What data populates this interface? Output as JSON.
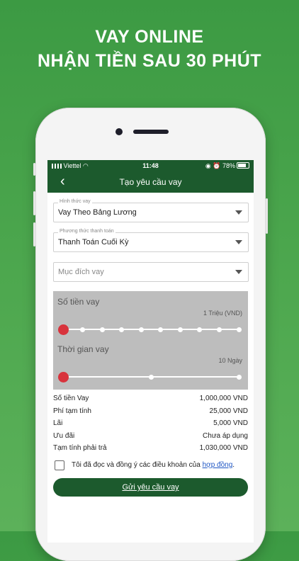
{
  "headline": {
    "line1": "VAY ONLINE",
    "line2": "NHẬN TIỀN SAU 30 PHÚT"
  },
  "status_bar": {
    "carrier": "Viettel",
    "time": "11:48",
    "battery": "78%",
    "battery_level": 0.78
  },
  "nav": {
    "title": "Tạo yêu cầu vay"
  },
  "form": {
    "loan_type": {
      "label": "Hình thức vay",
      "value": "Vay Theo Bảng Lương"
    },
    "payment_method": {
      "label": "Phương thức thanh toán",
      "value": "Thanh Toán Cuối Kỳ"
    },
    "purpose": {
      "placeholder": "Mục đích vay"
    }
  },
  "amount_slider": {
    "title": "Số tiền vay",
    "value_text": "1 Triệu (VND)",
    "steps": 10,
    "selected_index": 0
  },
  "term_slider": {
    "title": "Thời gian vay",
    "value_text": "10 Ngày",
    "steps": 3,
    "selected_index": 0
  },
  "summary": [
    {
      "label": "Số tiền Vay",
      "value": "1,000,000 VND"
    },
    {
      "label": "Phí tạm tính",
      "value": "25,000 VND"
    },
    {
      "label": "Lãi",
      "value": "5,000 VND"
    },
    {
      "label": "Ưu đãi",
      "value": "Chưa áp dụng"
    },
    {
      "label": "Tạm tính phải trả",
      "value": "1,030,000 VND"
    }
  ],
  "agreement": {
    "text": "Tôi đã đọc và đồng ý các điều khoản của ",
    "link": "hợp đồng",
    "suffix": ".",
    "checked": false
  },
  "submit_label": "Gửi yêu cầu vay"
}
